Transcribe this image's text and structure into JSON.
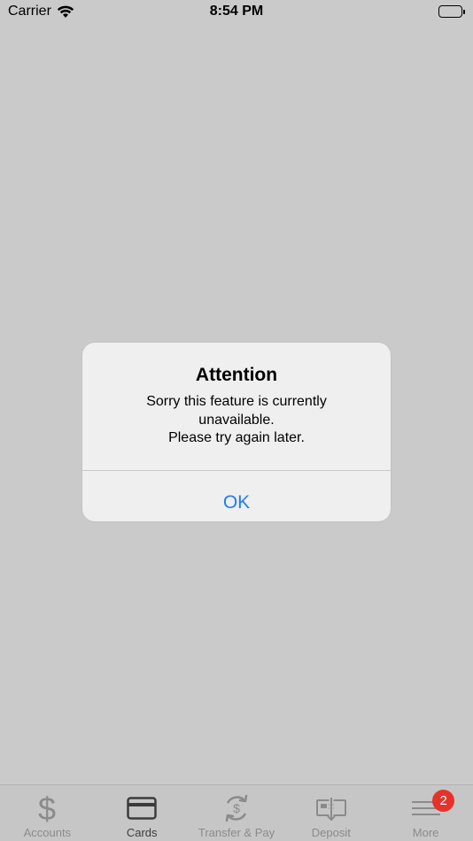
{
  "status_bar": {
    "carrier": "Carrier",
    "time": "8:54 PM"
  },
  "alert": {
    "title": "Attention",
    "message_lines": [
      "Sorry this feature is currently",
      "unavailable.",
      "Please try again later."
    ],
    "ok_label": "OK"
  },
  "tab_bar": {
    "tabs": [
      {
        "label": "Accounts",
        "icon": "dollar-icon",
        "active": false
      },
      {
        "label": "Cards",
        "icon": "credit-card-icon",
        "active": true
      },
      {
        "label": "Transfer & Pay",
        "icon": "transfer-pay-icon",
        "active": false
      },
      {
        "label": "Deposit",
        "icon": "deposit-check-icon",
        "active": false
      },
      {
        "label": "More",
        "icon": "menu-lines-icon",
        "active": false,
        "badge": "2"
      }
    ]
  },
  "colors": {
    "background": "#cacaca",
    "alert_background": "#efefef",
    "link_blue": "#1e7ef2",
    "badge_red": "#e5332a",
    "tab_inactive": "#8b8b8b",
    "tab_active": "#3c3c3c"
  }
}
